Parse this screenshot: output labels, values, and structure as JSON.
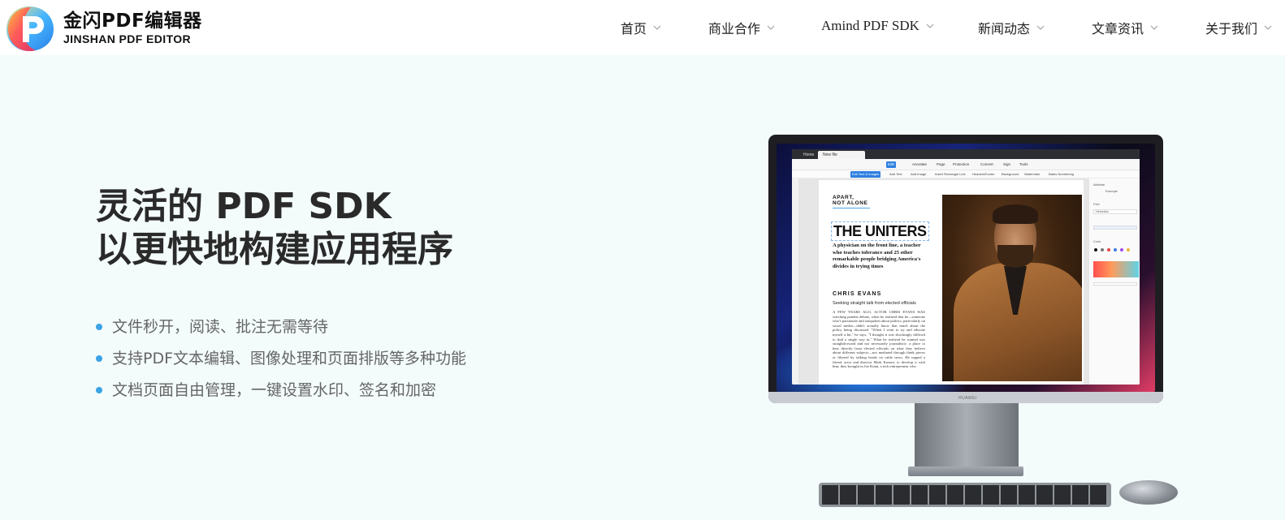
{
  "brand": {
    "name_cn": "金闪PDF编辑器",
    "name_en": "JINSHAN PDF EDITOR"
  },
  "nav": {
    "items": [
      {
        "label": "首页"
      },
      {
        "label": "商业合作"
      },
      {
        "label": "Amind PDF SDK"
      },
      {
        "label": "新闻动态"
      },
      {
        "label": "文章资讯"
      },
      {
        "label": "关于我们"
      }
    ]
  },
  "hero": {
    "headline_line1": "灵活的 PDF SDK",
    "headline_line2": "以更快地构建应用程序",
    "features": [
      "文件秒开，阅读、批注无需等待",
      "支持PDF文本编辑、图像处理和页面排版等多种功能",
      "文档页面自由管理，一键设置水印、签名和加密"
    ]
  },
  "mockup": {
    "monitor_brand": "HUAWEI",
    "tabs": [
      "Home",
      "New file"
    ],
    "toolbar": [
      "Edit",
      "Annotate",
      "Page",
      "Protection",
      "Convert",
      "Sign",
      "Tools"
    ],
    "subbar": [
      "Edit Text & Images",
      "Add Text",
      "Add Image",
      "Insert Rectangle Link",
      "Header&Footer",
      "Background",
      "Watermark",
      "Bates Numbering"
    ],
    "doc": {
      "kicker": "APART,\nNOT ALONE",
      "title": "THE UNITERS",
      "subtitle": "A physician on the front line, a teacher who teaches tolerance and 25 other remarkable people bridging America's divides in trying times",
      "author": "CHRIS EVANS",
      "lede": "Seeking straight talk from elected officials",
      "body": "A FEW YEARS AGO, ACTOR CHRIS EVANS WAS watching pundits debate, when he realized that he—someone who's passionate and outspoken about politics, particularly on social media—didn't actually know that much about the policy being discussed. \"When I went to try and educate myself a bit,\" he says, \"I thought it was shockingly difficult to find a single way in.\" What he realized he wanted was straightforward and not necessarily journalistic: a place to hear directly from elected officials on what they believe about different subjects—not mediated through think pieces or filtered by talking heads on cable news. He tapped a friend, actor and director Mark Kassen, to develop it with him; they brought in Joe Kiani, a tech entrepreneur who"
    },
    "right_panel": {
      "section": "Attribute",
      "font_label": "Font",
      "font_value": "Helvetica",
      "color_label": "Color",
      "sample": "Example"
    }
  },
  "colors": {
    "accent": "#3aa3e6",
    "background": "#f3fbfb",
    "headline": "#2a2a2a"
  }
}
